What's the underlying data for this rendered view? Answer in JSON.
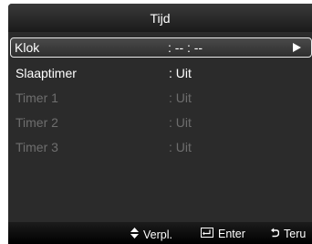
{
  "menu": {
    "title": "Tijd",
    "items": [
      {
        "label": "Klok",
        "value": ": -- : --",
        "selected": true,
        "enabled": true
      },
      {
        "label": "Slaaptimer",
        "value": ": Uit",
        "selected": false,
        "enabled": true
      },
      {
        "label": "Timer 1",
        "value": ": Uit",
        "selected": false,
        "enabled": false
      },
      {
        "label": "Timer 2",
        "value": ": Uit",
        "selected": false,
        "enabled": false
      },
      {
        "label": "Timer 3",
        "value": ": Uit",
        "selected": false,
        "enabled": false
      }
    ]
  },
  "footer": {
    "move_label": "Verpl.",
    "move_icon": "up-down-arrow-icon",
    "enter_label": "Enter",
    "enter_icon": "enter-key-icon",
    "return_label": "Teru",
    "return_icon": "return-arrow-icon"
  },
  "colors": {
    "background": "#0a0a0a",
    "text_active": "#ffffff",
    "text_disabled": "#6e6e6e",
    "highlight_border": "#e9e9e9"
  }
}
